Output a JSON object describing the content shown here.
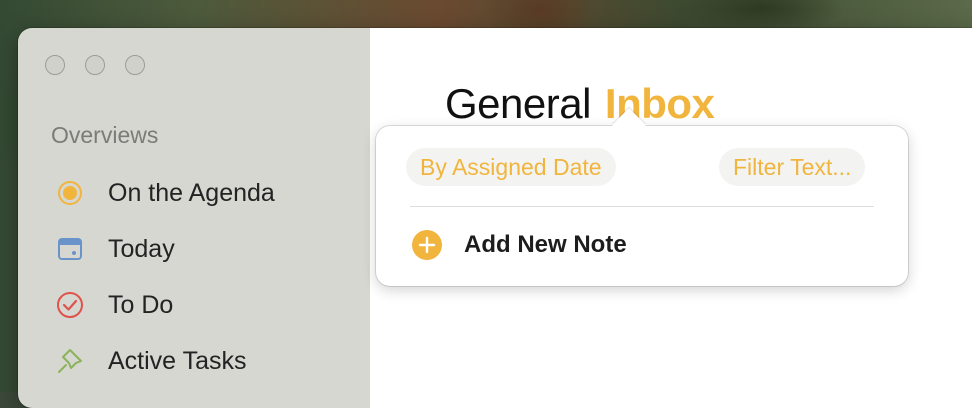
{
  "sidebar": {
    "section_title": "Overviews",
    "items": [
      {
        "label": "On the Agenda",
        "icon": "agenda-dot-icon",
        "color": "#f1b53e"
      },
      {
        "label": "Today",
        "icon": "calendar-icon",
        "color": "#6a93c9"
      },
      {
        "label": "To Do",
        "icon": "checkmark-circle-icon",
        "color": "#e0524c"
      },
      {
        "label": "Active Tasks",
        "icon": "pin-icon",
        "color": "#8bb35a"
      }
    ]
  },
  "main": {
    "title_prefix": "General",
    "title_accent": "Inbox"
  },
  "popover": {
    "sort_button": "By Assigned Date",
    "filter_placeholder": "Filter Text...",
    "add_note_label": "Add New Note"
  },
  "colors": {
    "accent": "#f1b53e"
  }
}
